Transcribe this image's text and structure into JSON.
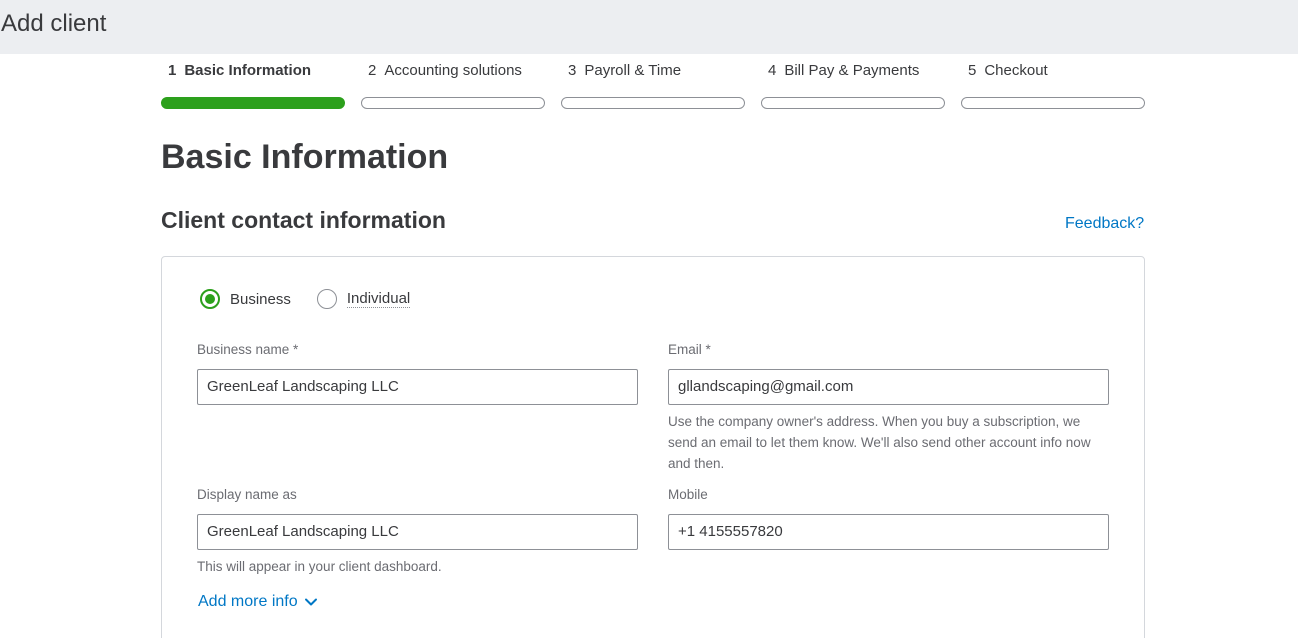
{
  "header": {
    "title": "Add client"
  },
  "steps": [
    {
      "num": "1",
      "label": "Basic Information",
      "active": true
    },
    {
      "num": "2",
      "label": "Accounting solutions",
      "active": false
    },
    {
      "num": "3",
      "label": "Payroll & Time",
      "active": false
    },
    {
      "num": "4",
      "label": "Bill Pay & Payments",
      "active": false
    },
    {
      "num": "5",
      "label": "Checkout",
      "active": false
    }
  ],
  "page": {
    "title": "Basic Information",
    "section_title": "Client contact information",
    "feedback": "Feedback?"
  },
  "form": {
    "type_options": [
      {
        "label": "Business",
        "selected": true
      },
      {
        "label": "Individual",
        "selected": false
      }
    ],
    "business_name": {
      "label": "Business name *",
      "value": "GreenLeaf Landscaping LLC"
    },
    "email": {
      "label": "Email *",
      "value": "gllandscaping@gmail.com",
      "hint": "Use the company owner's address. When you buy a subscription, we send an email to let them know. We'll also send other account info now and then."
    },
    "display_name": {
      "label": "Display name as",
      "value": "GreenLeaf Landscaping LLC",
      "hint": "This will appear in your client dashboard."
    },
    "mobile": {
      "label": "Mobile",
      "value": "+1 4155557820"
    },
    "add_more": "Add more info"
  },
  "colors": {
    "accent_green": "#2ca01c",
    "link_blue": "#0077c5",
    "topbar_bg": "#eceef1"
  }
}
